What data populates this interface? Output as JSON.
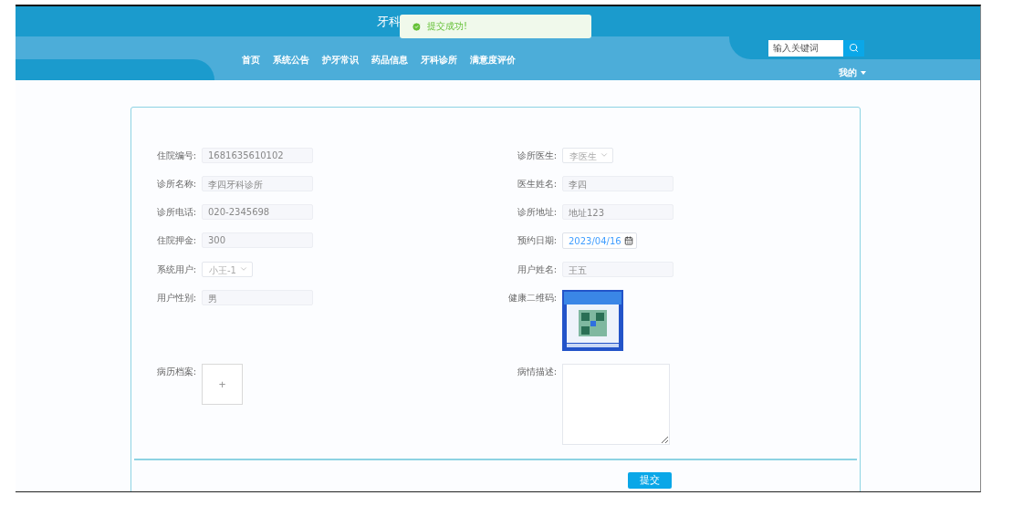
{
  "header": {
    "title": "牙科",
    "nav": [
      "首页",
      "系统公告",
      "护牙常识",
      "药品信息",
      "牙科诊所",
      "满意度评价"
    ],
    "search": {
      "placeholder": "输入关键词"
    },
    "user_menu": "我的"
  },
  "toast": {
    "kind": "success",
    "message": "提交成功!"
  },
  "form": {
    "rows": [
      {
        "left": {
          "label": "住院编号:",
          "kind": "input",
          "value": "1681635610102"
        },
        "right": {
          "label": "诊所医生:",
          "kind": "select",
          "value": "李医生"
        }
      },
      {
        "left": {
          "label": "诊所名称:",
          "kind": "input",
          "value": "李四牙科诊所"
        },
        "right": {
          "label": "医生姓名:",
          "kind": "input",
          "value": "李四"
        }
      },
      {
        "left": {
          "label": "诊所电话:",
          "kind": "input",
          "value": "020-2345698"
        },
        "right": {
          "label": "诊所地址:",
          "kind": "input",
          "value": "地址123"
        }
      },
      {
        "left": {
          "label": "住院押金:",
          "kind": "input",
          "value": "300"
        },
        "right": {
          "label": "预约日期:",
          "kind": "date",
          "value": "2023/04/16"
        }
      },
      {
        "left": {
          "label": "系统用户:",
          "kind": "select",
          "value": "小王-1"
        },
        "right": {
          "label": "用户姓名:",
          "kind": "input",
          "value": "王五"
        }
      },
      {
        "left": {
          "label": "用户性别:",
          "kind": "input",
          "value": "男"
        },
        "right": {
          "label": "健康二维码:",
          "kind": "picture"
        }
      },
      {
        "left": {
          "label": "病历档案:",
          "kind": "upload",
          "value": "+"
        },
        "right": {
          "label": "病情描述:",
          "kind": "textarea"
        }
      }
    ],
    "submit": "提交"
  }
}
